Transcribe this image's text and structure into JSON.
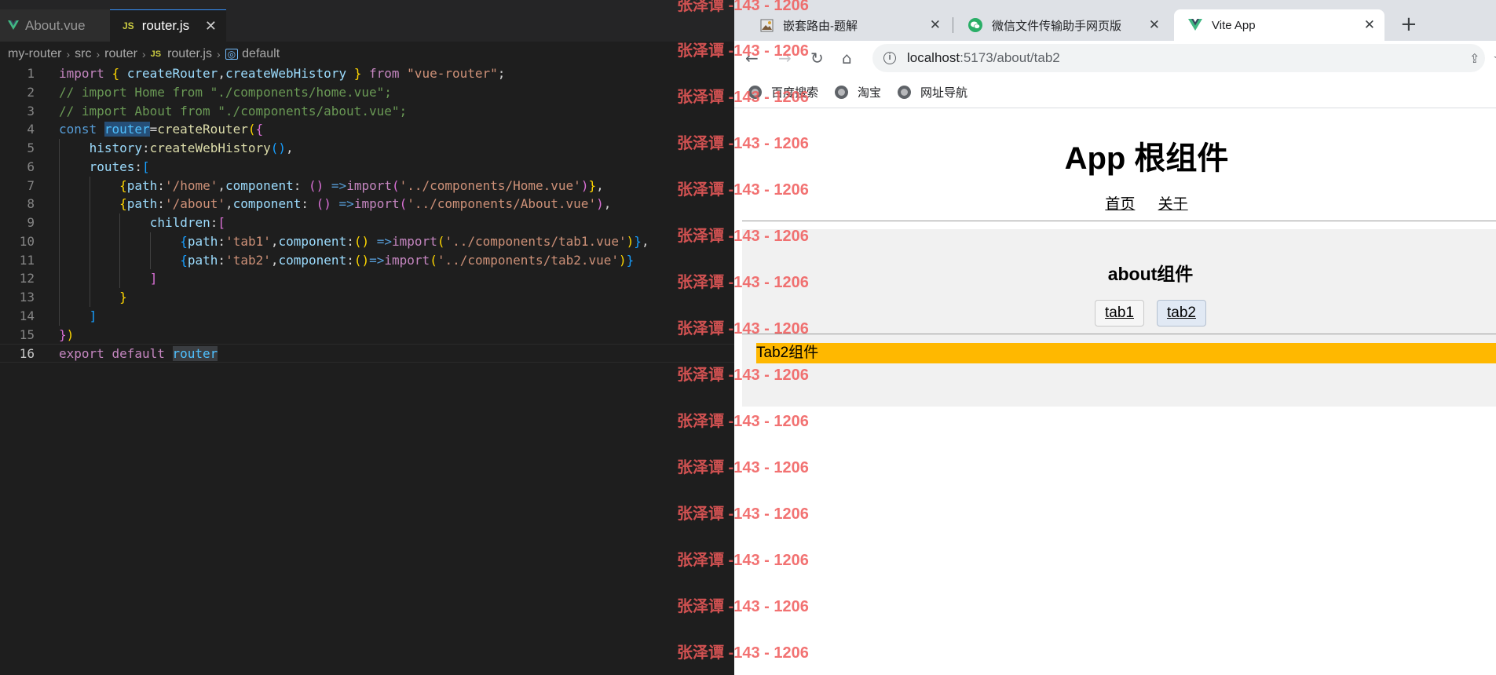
{
  "editor": {
    "tabs": [
      {
        "label": "About.vue",
        "icon": "vue-icon",
        "active": false
      },
      {
        "label": "router.js",
        "icon": "js-icon",
        "active": true
      }
    ],
    "breadcrumb": [
      "my-router",
      "src",
      "router",
      "router.js",
      "default"
    ],
    "breadcrumb_js_badge": "JS",
    "tab_js_badge": "JS",
    "line_numbers": [
      "1",
      "2",
      "3",
      "4",
      "5",
      "6",
      "7",
      "8",
      "9",
      "10",
      "11",
      "12",
      "13",
      "14",
      "15",
      "16"
    ],
    "code_lines": [
      "import { createRouter,createWebHistory } from \"vue-router\";",
      "// import Home from \"./components/home.vue\";",
      "// import About from \"./components/about.vue\";",
      "const router=createRouter({",
      "    history:createWebHistory(),",
      "    routes:[",
      "        {path:'/home',component: () =>import('../components/Home.vue')},",
      "        {path:'/about',component: () =>import('../components/About.vue'),",
      "            children:[",
      "                {path:'tab1',component:() =>import('../components/tab1.vue')},",
      "                {path:'tab2',component:()=>import('../components/tab2.vue')}",
      "            ]",
      "        }",
      "    ]",
      "})",
      "export default router"
    ]
  },
  "browser": {
    "tabs": [
      {
        "title": "嵌套路由-题解",
        "icon": "image-favicon-icon"
      },
      {
        "title": "微信文件传输助手网页版",
        "icon": "wechat-icon"
      },
      {
        "title": "Vite App",
        "icon": "vue-icon",
        "active": true
      }
    ],
    "url_host": "localhost",
    "url_rest": ":5173/about/tab2",
    "bookmarks": [
      "百度搜索",
      "淘宝",
      "网址导航"
    ],
    "page": {
      "app_title": "App 根组件",
      "nav_links": [
        "首页",
        "关于"
      ],
      "about_title": "about组件",
      "sub_tabs": [
        "tab1",
        "tab2"
      ],
      "tab2_content": "Tab2组件"
    }
  },
  "watermark": "张泽谭 -143 - 1206",
  "colors": {
    "editor_bg": "#1e1e1e",
    "accent_blue": "#3794ff",
    "tab2_bar": "#ffb800",
    "watermark": "#f05a5a"
  }
}
